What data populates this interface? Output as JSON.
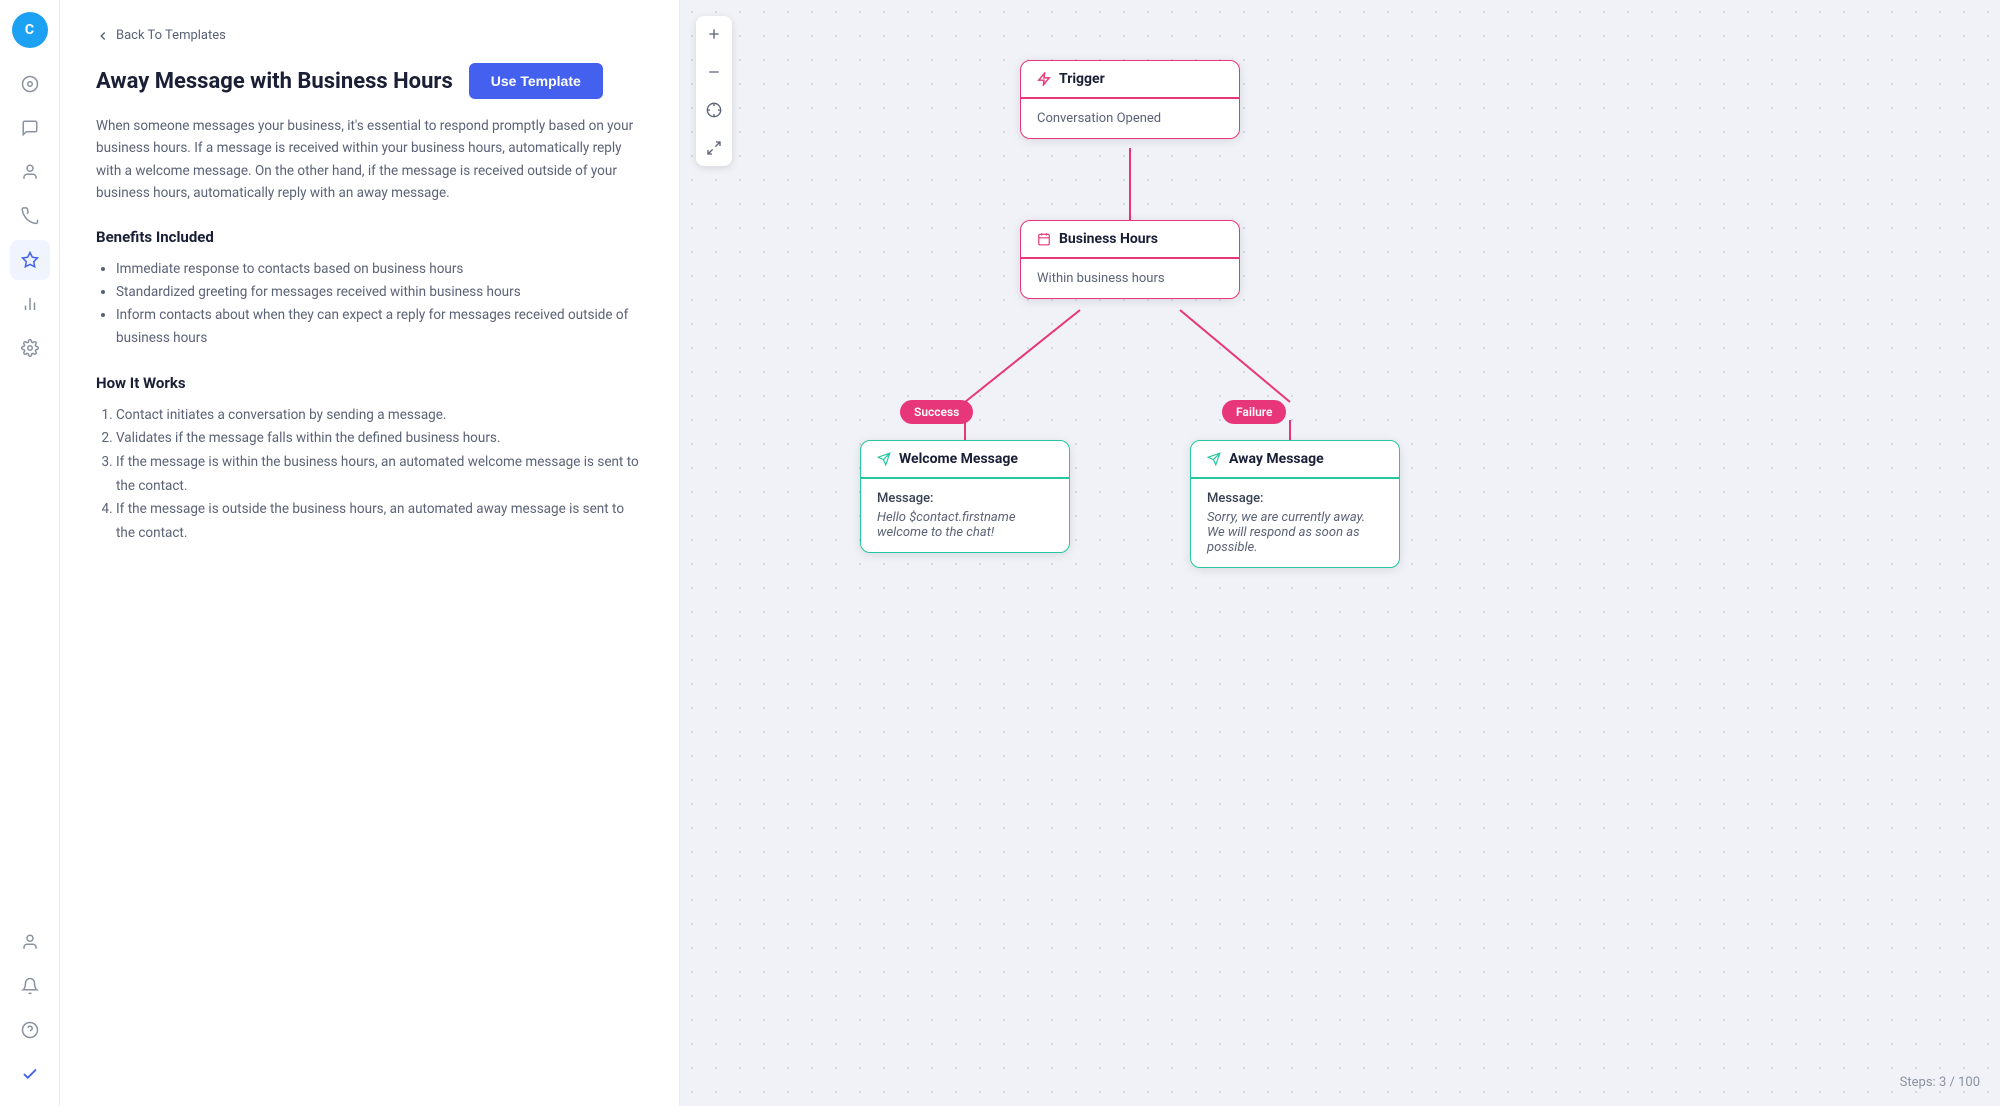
{
  "sidebar": {
    "avatar_letter": "C",
    "items": [
      {
        "name": "dashboard-icon",
        "symbol": "⊙",
        "active": false
      },
      {
        "name": "chat-icon",
        "symbol": "💬",
        "active": false
      },
      {
        "name": "contacts-icon",
        "symbol": "👤",
        "active": false
      },
      {
        "name": "broadcast-icon",
        "symbol": "📡",
        "active": false
      },
      {
        "name": "automations-icon",
        "symbol": "⬡",
        "active": true
      },
      {
        "name": "reports-icon",
        "symbol": "📊",
        "active": false
      },
      {
        "name": "settings-icon",
        "symbol": "⚙",
        "active": false
      }
    ],
    "bottom_items": [
      {
        "name": "profile-icon",
        "symbol": "👤"
      },
      {
        "name": "notifications-icon",
        "symbol": "🔔"
      },
      {
        "name": "help-icon",
        "symbol": "❓"
      },
      {
        "name": "checkmark-icon",
        "symbol": "✔"
      }
    ]
  },
  "back_link": "Back To Templates",
  "page_title": "Away Message with Business Hours",
  "use_template_label": "Use Template",
  "description": "When someone messages your business, it's essential to respond promptly based on your business hours. If a message is received within your business hours, automatically reply with a welcome message. On the other hand, if the message is received outside of your business hours, automatically reply with an away message.",
  "benefits": {
    "title": "Benefits Included",
    "items": [
      "Immediate response to contacts based on business hours",
      "Standardized greeting for messages received within business hours",
      "Inform contacts about when they can expect a reply for messages received outside of business hours"
    ]
  },
  "how_it_works": {
    "title": "How It Works",
    "items": [
      "Contact initiates a conversation by sending a message.",
      "Validates if the message falls within the defined business hours.",
      "If the message is within the business hours, an automated welcome message is sent to the contact.",
      "If the message is outside the business hours, an automated away message is sent to the contact."
    ]
  },
  "flow": {
    "trigger_node": {
      "header": "Trigger",
      "body": "Conversation Opened"
    },
    "biz_hours_node": {
      "header": "Business Hours",
      "body": "Within business hours"
    },
    "success_badge": "Success",
    "failure_badge": "Failure",
    "welcome_node": {
      "header": "Welcome Message",
      "message_label": "Message:",
      "message_body": "Hello $contact.firstname welcome to the chat!"
    },
    "away_node": {
      "header": "Away Message",
      "message_label": "Message:",
      "message_body": "Sorry, we are currently away. We will respond as soon as possible."
    }
  },
  "steps": {
    "label": "Steps:",
    "current": "3",
    "max": "100"
  }
}
